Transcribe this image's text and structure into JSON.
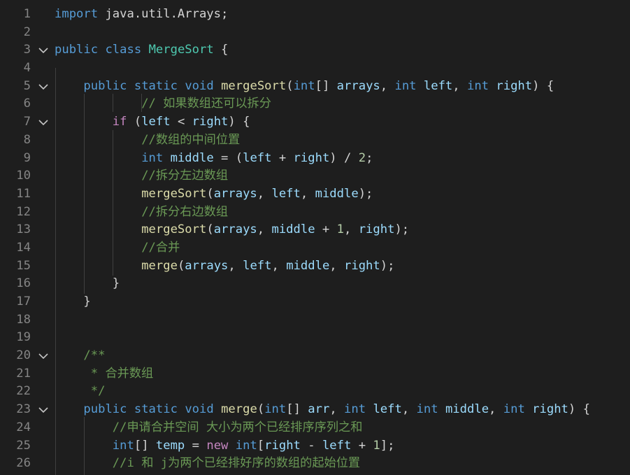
{
  "colors": {
    "background": "#1e1e1e",
    "line_number": "#858585",
    "keyword": "#569cd6",
    "control": "#c586c0",
    "type": "#4ec9b0",
    "function": "#dcdcaa",
    "variable": "#9cdcfe",
    "number": "#b5cea8",
    "comment": "#6a9955",
    "plain": "#d4d4d4"
  },
  "fold_icon": "chevron-down-icon",
  "lines": [
    {
      "n": "1",
      "fold": false,
      "tokens": [
        [
          "keyword",
          "import"
        ],
        [
          "plain",
          " java.util.Arrays;"
        ]
      ]
    },
    {
      "n": "2",
      "fold": false,
      "tokens": []
    },
    {
      "n": "3",
      "fold": true,
      "tokens": [
        [
          "keyword",
          "public"
        ],
        [
          "plain",
          " "
        ],
        [
          "keyword",
          "class"
        ],
        [
          "plain",
          " "
        ],
        [
          "type",
          "MergeSort"
        ],
        [
          "plain",
          " {"
        ]
      ]
    },
    {
      "n": "4",
      "fold": false,
      "tokens": []
    },
    {
      "n": "5",
      "fold": true,
      "tokens": [
        [
          "plain",
          "    "
        ],
        [
          "keyword",
          "public"
        ],
        [
          "plain",
          " "
        ],
        [
          "keyword",
          "static"
        ],
        [
          "plain",
          " "
        ],
        [
          "keyword",
          "void"
        ],
        [
          "plain",
          " "
        ],
        [
          "func",
          "mergeSort"
        ],
        [
          "plain",
          "("
        ],
        [
          "keyword",
          "int"
        ],
        [
          "plain",
          "[] "
        ],
        [
          "var",
          "arrays"
        ],
        [
          "plain",
          ", "
        ],
        [
          "keyword",
          "int"
        ],
        [
          "plain",
          " "
        ],
        [
          "var",
          "left"
        ],
        [
          "plain",
          ", "
        ],
        [
          "keyword",
          "int"
        ],
        [
          "plain",
          " "
        ],
        [
          "var",
          "right"
        ],
        [
          "plain",
          ") {"
        ]
      ]
    },
    {
      "n": "6",
      "fold": false,
      "tokens": [
        [
          "plain",
          "            "
        ],
        [
          "comment",
          "// 如果数组还可以拆分"
        ]
      ]
    },
    {
      "n": "7",
      "fold": true,
      "tokens": [
        [
          "plain",
          "        "
        ],
        [
          "control",
          "if"
        ],
        [
          "plain",
          " ("
        ],
        [
          "var",
          "left"
        ],
        [
          "plain",
          " < "
        ],
        [
          "var",
          "right"
        ],
        [
          "plain",
          ") {"
        ]
      ]
    },
    {
      "n": "8",
      "fold": false,
      "tokens": [
        [
          "plain",
          "            "
        ],
        [
          "comment",
          "//数组的中间位置"
        ]
      ]
    },
    {
      "n": "9",
      "fold": false,
      "tokens": [
        [
          "plain",
          "            "
        ],
        [
          "keyword",
          "int"
        ],
        [
          "plain",
          " "
        ],
        [
          "var",
          "middle"
        ],
        [
          "plain",
          " = ("
        ],
        [
          "var",
          "left"
        ],
        [
          "plain",
          " + "
        ],
        [
          "var",
          "right"
        ],
        [
          "plain",
          ") / "
        ],
        [
          "num",
          "2"
        ],
        [
          "plain",
          ";"
        ]
      ]
    },
    {
      "n": "10",
      "fold": false,
      "tokens": [
        [
          "plain",
          "            "
        ],
        [
          "comment",
          "//拆分左边数组"
        ]
      ]
    },
    {
      "n": "11",
      "fold": false,
      "tokens": [
        [
          "plain",
          "            "
        ],
        [
          "func",
          "mergeSort"
        ],
        [
          "plain",
          "("
        ],
        [
          "var",
          "arrays"
        ],
        [
          "plain",
          ", "
        ],
        [
          "var",
          "left"
        ],
        [
          "plain",
          ", "
        ],
        [
          "var",
          "middle"
        ],
        [
          "plain",
          ");"
        ]
      ]
    },
    {
      "n": "12",
      "fold": false,
      "tokens": [
        [
          "plain",
          "            "
        ],
        [
          "comment",
          "//拆分右边数组"
        ]
      ]
    },
    {
      "n": "13",
      "fold": false,
      "tokens": [
        [
          "plain",
          "            "
        ],
        [
          "func",
          "mergeSort"
        ],
        [
          "plain",
          "("
        ],
        [
          "var",
          "arrays"
        ],
        [
          "plain",
          ", "
        ],
        [
          "var",
          "middle"
        ],
        [
          "plain",
          " + "
        ],
        [
          "num",
          "1"
        ],
        [
          "plain",
          ", "
        ],
        [
          "var",
          "right"
        ],
        [
          "plain",
          ");"
        ]
      ]
    },
    {
      "n": "14",
      "fold": false,
      "tokens": [
        [
          "plain",
          "            "
        ],
        [
          "comment",
          "//合并"
        ]
      ]
    },
    {
      "n": "15",
      "fold": false,
      "tokens": [
        [
          "plain",
          "            "
        ],
        [
          "func",
          "merge"
        ],
        [
          "plain",
          "("
        ],
        [
          "var",
          "arrays"
        ],
        [
          "plain",
          ", "
        ],
        [
          "var",
          "left"
        ],
        [
          "plain",
          ", "
        ],
        [
          "var",
          "middle"
        ],
        [
          "plain",
          ", "
        ],
        [
          "var",
          "right"
        ],
        [
          "plain",
          ");"
        ]
      ]
    },
    {
      "n": "16",
      "fold": false,
      "tokens": [
        [
          "plain",
          "        }"
        ]
      ]
    },
    {
      "n": "17",
      "fold": false,
      "tokens": [
        [
          "plain",
          "    }"
        ]
      ]
    },
    {
      "n": "18",
      "fold": false,
      "tokens": []
    },
    {
      "n": "19",
      "fold": false,
      "tokens": []
    },
    {
      "n": "20",
      "fold": true,
      "tokens": [
        [
          "plain",
          "    "
        ],
        [
          "comment",
          "/**"
        ]
      ]
    },
    {
      "n": "21",
      "fold": false,
      "tokens": [
        [
          "plain",
          "     "
        ],
        [
          "comment",
          "* 合并数组"
        ]
      ]
    },
    {
      "n": "22",
      "fold": false,
      "tokens": [
        [
          "plain",
          "     "
        ],
        [
          "comment",
          "*/"
        ]
      ]
    },
    {
      "n": "23",
      "fold": true,
      "tokens": [
        [
          "plain",
          "    "
        ],
        [
          "keyword",
          "public"
        ],
        [
          "plain",
          " "
        ],
        [
          "keyword",
          "static"
        ],
        [
          "plain",
          " "
        ],
        [
          "keyword",
          "void"
        ],
        [
          "plain",
          " "
        ],
        [
          "func",
          "merge"
        ],
        [
          "plain",
          "("
        ],
        [
          "keyword",
          "int"
        ],
        [
          "plain",
          "[] "
        ],
        [
          "var",
          "arr"
        ],
        [
          "plain",
          ", "
        ],
        [
          "keyword",
          "int"
        ],
        [
          "plain",
          " "
        ],
        [
          "var",
          "left"
        ],
        [
          "plain",
          ", "
        ],
        [
          "keyword",
          "int"
        ],
        [
          "plain",
          " "
        ],
        [
          "var",
          "middle"
        ],
        [
          "plain",
          ", "
        ],
        [
          "keyword",
          "int"
        ],
        [
          "plain",
          " "
        ],
        [
          "var",
          "right"
        ],
        [
          "plain",
          ") {"
        ]
      ]
    },
    {
      "n": "24",
      "fold": false,
      "tokens": [
        [
          "plain",
          "        "
        ],
        [
          "comment",
          "//申请合并空间 大小为两个已经排序序列之和"
        ]
      ]
    },
    {
      "n": "25",
      "fold": false,
      "tokens": [
        [
          "plain",
          "        "
        ],
        [
          "keyword",
          "int"
        ],
        [
          "plain",
          "[] "
        ],
        [
          "var",
          "temp"
        ],
        [
          "plain",
          " = "
        ],
        [
          "control",
          "new"
        ],
        [
          "plain",
          " "
        ],
        [
          "keyword",
          "int"
        ],
        [
          "plain",
          "["
        ],
        [
          "var",
          "right"
        ],
        [
          "plain",
          " - "
        ],
        [
          "var",
          "left"
        ],
        [
          "plain",
          " + "
        ],
        [
          "num",
          "1"
        ],
        [
          "plain",
          "];"
        ]
      ]
    },
    {
      "n": "26",
      "fold": false,
      "tokens": [
        [
          "plain",
          "        "
        ],
        [
          "comment",
          "//i 和 j为两个已经排好序的数组的起始位置"
        ]
      ]
    }
  ]
}
